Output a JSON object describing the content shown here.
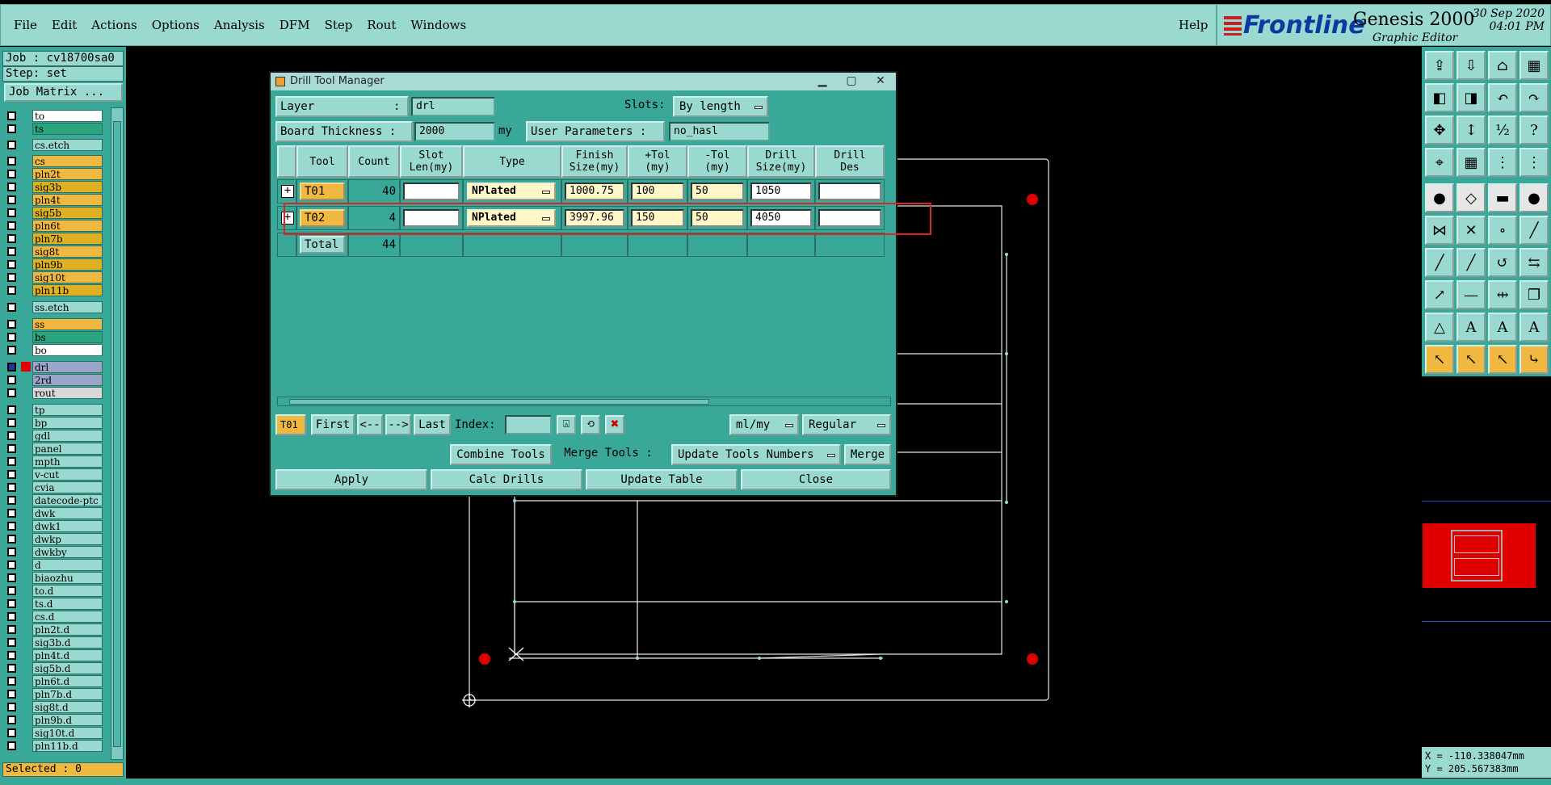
{
  "menubar": {
    "items": [
      {
        "label": "File"
      },
      {
        "label": "Edit"
      },
      {
        "label": "Actions"
      },
      {
        "label": "Options"
      },
      {
        "label": "Analysis"
      },
      {
        "label": "DFM"
      },
      {
        "label": "Step"
      },
      {
        "label": "Rout"
      },
      {
        "label": "Windows"
      }
    ],
    "help": "Help"
  },
  "branding": {
    "logo_text": "Frontline",
    "product": "Genesis 2000",
    "subtitle": "Graphic Editor",
    "date": "30 Sep 2020",
    "time": "04:01 PM"
  },
  "left_panel": {
    "job": "Job : cv18700sa0",
    "step": "Step: set",
    "job_matrix": "Job Matrix ...",
    "layers": [
      {
        "name": "to",
        "color": "#ffffff"
      },
      {
        "name": "ts",
        "color": "#2aa57e"
      },
      {
        "name": "cs.etch",
        "color": "#9ad9d0"
      },
      {
        "name": "cs",
        "color": "#f0b840"
      },
      {
        "name": "pln2t",
        "color": "#f0b840"
      },
      {
        "name": "sig3b",
        "color": "#e0b020"
      },
      {
        "name": "pln4t",
        "color": "#f0b840"
      },
      {
        "name": "sig5b",
        "color": "#e0b020"
      },
      {
        "name": "pln6t",
        "color": "#f0b840"
      },
      {
        "name": "pln7b",
        "color": "#e0b020"
      },
      {
        "name": "sig8t",
        "color": "#f0b840"
      },
      {
        "name": "pln9b",
        "color": "#e0b020"
      },
      {
        "name": "sig10t",
        "color": "#f0b840"
      },
      {
        "name": "pln11b",
        "color": "#e0b020"
      },
      {
        "name": "ss.etch",
        "color": "#9ad9d0"
      },
      {
        "name": "ss",
        "color": "#f0b840"
      },
      {
        "name": "bs",
        "color": "#2aa57e"
      },
      {
        "name": "bo",
        "color": "#ffffff"
      },
      {
        "name": "drl",
        "color": "#9aa6c8"
      },
      {
        "name": "2rd",
        "color": "#9aa6c8"
      },
      {
        "name": "rout",
        "color": "#d8d8d8"
      },
      {
        "name": "tp",
        "color": "#9ad9d0"
      },
      {
        "name": "bp",
        "color": "#9ad9d0"
      },
      {
        "name": "gdl",
        "color": "#9ad9d0"
      },
      {
        "name": "panel",
        "color": "#9ad9d0"
      },
      {
        "name": "mpth",
        "color": "#9ad9d0"
      },
      {
        "name": "v-cut",
        "color": "#9ad9d0"
      },
      {
        "name": "cvia",
        "color": "#9ad9d0"
      },
      {
        "name": "datecode-ptc",
        "color": "#9ad9d0"
      },
      {
        "name": "dwk",
        "color": "#9ad9d0"
      },
      {
        "name": "dwk1",
        "color": "#9ad9d0"
      },
      {
        "name": "dwkp",
        "color": "#9ad9d0"
      },
      {
        "name": "dwkby",
        "color": "#9ad9d0"
      },
      {
        "name": "d",
        "color": "#9ad9d0"
      },
      {
        "name": "biaozhu",
        "color": "#9ad9d0"
      },
      {
        "name": "to.d",
        "color": "#9ad9d0"
      },
      {
        "name": "ts.d",
        "color": "#9ad9d0"
      },
      {
        "name": "cs.d",
        "color": "#9ad9d0"
      },
      {
        "name": "pln2t.d",
        "color": "#9ad9d0"
      },
      {
        "name": "sig3b.d",
        "color": "#9ad9d0"
      },
      {
        "name": "pln4t.d",
        "color": "#9ad9d0"
      },
      {
        "name": "sig5b.d",
        "color": "#9ad9d0"
      },
      {
        "name": "pln6t.d",
        "color": "#9ad9d0"
      },
      {
        "name": "pln7b.d",
        "color": "#9ad9d0"
      },
      {
        "name": "sig8t.d",
        "color": "#9ad9d0"
      },
      {
        "name": "pln9b.d",
        "color": "#9ad9d0"
      },
      {
        "name": "sig10t.d",
        "color": "#9ad9d0"
      },
      {
        "name": "pln11b.d",
        "color": "#9ad9d0"
      }
    ],
    "selected": "Selected : 0"
  },
  "dialog": {
    "title": "Drill Tool Manager",
    "layer_label": "Layer",
    "layer_colon": ":",
    "layer_value": "drl",
    "slots_label": "Slots:",
    "slots_value": "By length",
    "thickness_label": "Board Thickness :",
    "thickness_value": "2000",
    "thickness_unit": "my",
    "user_params_label": "User Parameters :",
    "user_params_value": "no_hasl",
    "columns": [
      "",
      "Tool",
      "Count",
      "Slot\nLen(my)",
      "Type",
      "Finish\nSize(my)",
      "+Tol\n(my)",
      "-Tol\n(my)",
      "Drill\nSize(my)",
      "Drill\nDes"
    ],
    "rows": [
      {
        "tool": "T01",
        "count": "40",
        "slot_len": "",
        "type": "NPlated",
        "finish": "1000.75",
        "ptol": "100",
        "ntol": "50",
        "drill": "1050",
        "des": ""
      },
      {
        "tool": "T02",
        "count": "4",
        "slot_len": "",
        "type": "NPlated",
        "finish": "3997.96",
        "ptol": "150",
        "ntol": "50",
        "drill": "4050",
        "des": ""
      }
    ],
    "total_label": "Total",
    "total_count": "44",
    "nav": {
      "current_tool": "T01",
      "first": "First",
      "prev": "<--",
      "next": "-->",
      "last": "Last",
      "index_label": "Index:",
      "units": "ml/my",
      "mode": "Regular"
    },
    "combine_tools": "Combine Tools",
    "merge_tools_label": "Merge Tools :",
    "update_numbers": "Update Tools Numbers",
    "merge": "Merge",
    "apply": "Apply",
    "calc_drills": "Calc Drills",
    "update_table": "Update Table",
    "close": "Close"
  },
  "coords": {
    "x": "X = -110.338047mm",
    "y": "Y = 205.567383mm"
  },
  "colors": {
    "panel": "#3aa898",
    "light": "#9ad9d0",
    "highlight": "#f0b840",
    "pad": "#e00000"
  }
}
